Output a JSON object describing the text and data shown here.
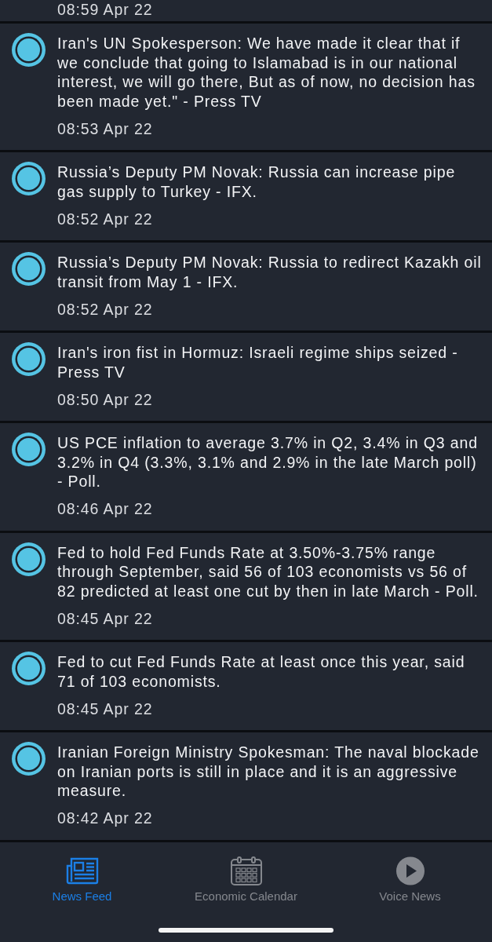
{
  "cut_off_item": {
    "time": "08:59 Apr 22"
  },
  "news_items": [
    {
      "headline": "Iran's UN Spokesperson: We have made it clear that if we conclude that going to Islamabad is in our national interest, we will go there, But as of now, no decision has been made yet.\" - Press TV",
      "time": "08:53 Apr 22"
    },
    {
      "headline": "Russia’s Deputy PM Novak: Russia can increase pipe gas supply to Turkey - IFX.",
      "time": "08:52 Apr 22"
    },
    {
      "headline": "Russia’s Deputy PM Novak: Russia to redirect Kazakh oil transit from May 1 - IFX.",
      "time": "08:52 Apr 22"
    },
    {
      "headline": "Iran's iron fist in Hormuz: Israeli regime ships seized - Press TV",
      "time": "08:50 Apr 22"
    },
    {
      "headline": "US PCE inflation to average 3.7% in Q2, 3.4% in Q3 and 3.2% in Q4 (3.3%, 3.1% and 2.9% in the late March poll) - Poll.",
      "time": "08:46 Apr 22"
    },
    {
      "headline": "Fed to hold Fed Funds Rate at 3.50%-3.75% range through September, said 56 of 103 economists vs 56 of 82 predicted at least one cut by then in late March - Poll.",
      "time": "08:45 Apr 22"
    },
    {
      "headline": "Fed to cut Fed Funds Rate at least once this year, said 71 of 103 economists.",
      "time": "08:45 Apr 22"
    },
    {
      "headline": "Iranian Foreign Ministry Spokesman: The naval blockade on Iranian ports is still in place and it is an aggressive measure.",
      "time": "08:42 Apr 22"
    }
  ],
  "tabs": [
    {
      "label": "News Feed",
      "kind": "newspaper",
      "selected": true
    },
    {
      "label": "Economic Calendar",
      "kind": "calendar",
      "selected": false
    },
    {
      "label": "Voice News",
      "kind": "voice",
      "selected": false
    }
  ]
}
